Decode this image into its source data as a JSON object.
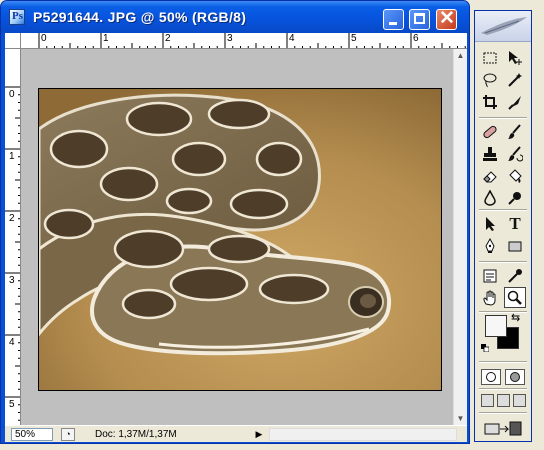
{
  "window": {
    "title": "P5291644. JPG @ 50% (RGB/8)"
  },
  "rulers": {
    "top_labels": [
      "0",
      "1",
      "2",
      "3",
      "4",
      "5",
      "6"
    ],
    "left_labels": [
      "0",
      "1",
      "2",
      "3",
      "4",
      "5"
    ]
  },
  "status": {
    "zoom": "50%",
    "doc_info": "Doc: 1,37M/1,37M"
  },
  "colors": {
    "titlebar": "#0753dd",
    "foreground_swatch": "#f7f7f7",
    "background_swatch": "#000000",
    "canvas_bg": "#bfbfbf"
  },
  "tools": [
    {
      "name": "marquee-tool",
      "icon": "rect-marquee"
    },
    {
      "name": "move-tool",
      "icon": "move-arrow"
    },
    {
      "name": "lasso-tool",
      "icon": "lasso"
    },
    {
      "name": "magic-wand-tool",
      "icon": "magic-wand"
    },
    {
      "name": "crop-tool",
      "icon": "crop"
    },
    {
      "name": "slice-tool",
      "icon": "slice-knife"
    },
    {
      "name": "healing-brush-tool",
      "icon": "bandage"
    },
    {
      "name": "brush-tool",
      "icon": "brush"
    },
    {
      "name": "clone-stamp-tool",
      "icon": "stamp"
    },
    {
      "name": "history-brush-tool",
      "icon": "history-brush"
    },
    {
      "name": "eraser-tool",
      "icon": "eraser"
    },
    {
      "name": "paint-bucket-tool",
      "icon": "bucket"
    },
    {
      "name": "blur-tool",
      "icon": "drop"
    },
    {
      "name": "dodge-tool",
      "icon": "dodge"
    },
    {
      "name": "path-selection-tool",
      "icon": "black-arrow"
    },
    {
      "name": "type-tool",
      "icon": "T"
    },
    {
      "name": "pen-tool",
      "icon": "pen"
    },
    {
      "name": "shape-tool",
      "icon": "rectangle"
    },
    {
      "name": "notes-tool",
      "icon": "note"
    },
    {
      "name": "eyedropper-tool",
      "icon": "eyedropper"
    },
    {
      "name": "hand-tool",
      "icon": "hand"
    },
    {
      "name": "zoom-tool",
      "icon": "magnifier"
    }
  ]
}
